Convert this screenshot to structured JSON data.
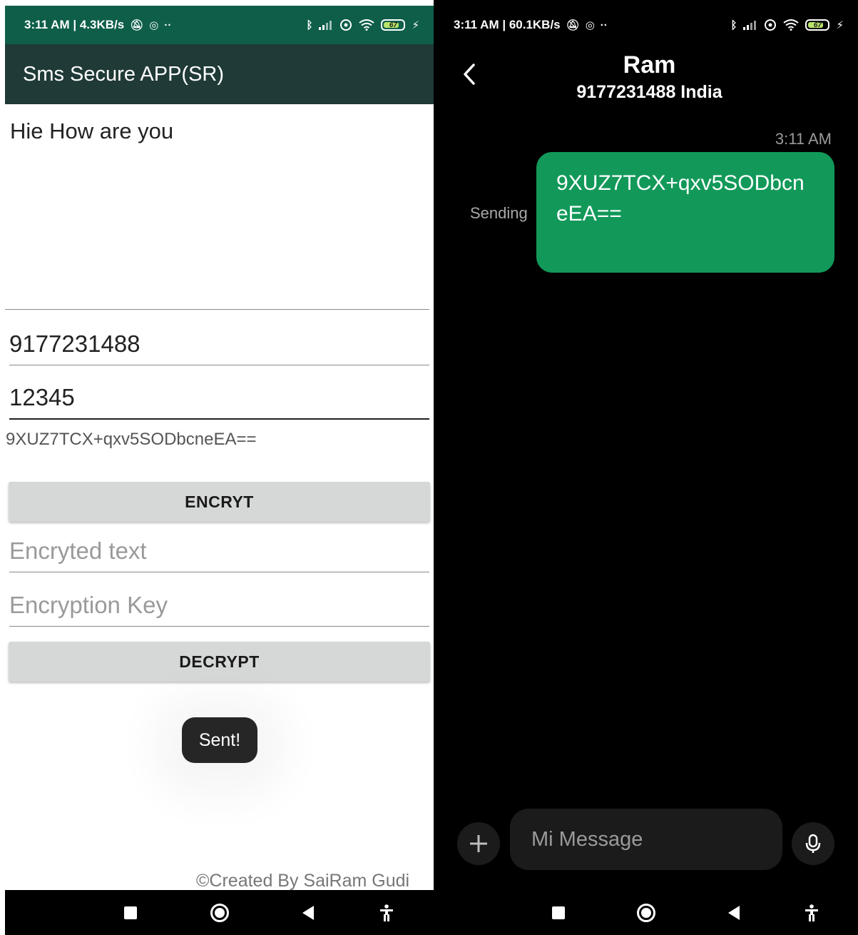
{
  "left_phone": {
    "status": {
      "time_speed": "3:11 AM | 4.3KB/s",
      "battery": "67"
    },
    "app_title": "Sms Secure APP(SR)",
    "message_text": "Hie How are you",
    "phone_number": "9177231488",
    "key": "12345",
    "cipher_text": "9XUZ7TCX+qxv5SODbcneEA==",
    "encrypt_label": "ENCRYT",
    "encrypted_text_placeholder": "Encryted text",
    "encryption_key_placeholder": "Encryption Key",
    "decrypt_label": "DECRYPT",
    "toast": "Sent!",
    "credit": "©Created By SaiRam Gudi"
  },
  "right_phone": {
    "status": {
      "time_speed": "3:11 AM | 60.1KB/s",
      "battery": "67"
    },
    "contact_name": "Ram",
    "contact_detail": "9177231488 India",
    "message_time": "3:11 AM",
    "sending_label": "Sending",
    "message_text": "9XUZ7TCX+qxv5SODbcneEA==",
    "compose_placeholder": "Mi Message"
  }
}
